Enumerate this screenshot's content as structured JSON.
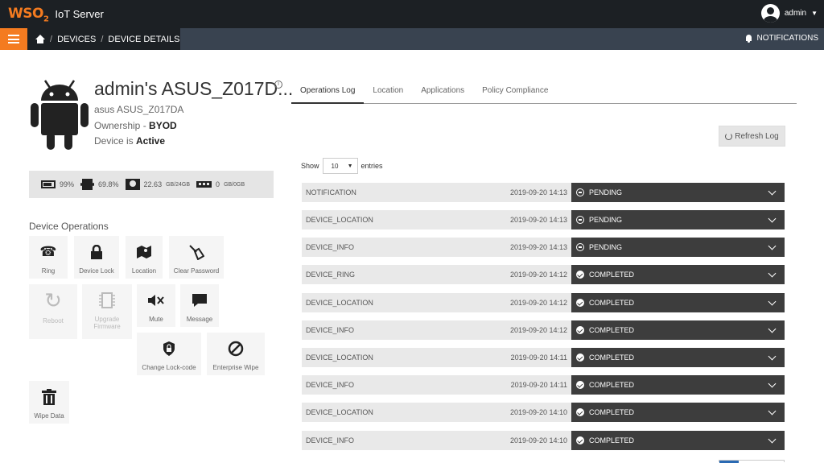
{
  "header": {
    "logo_text": "WSO",
    "logo_sub": "2",
    "app_title": "IoT Server",
    "user_name": "admin",
    "user_avatar_icon": "user-icon"
  },
  "navbar": {
    "menu_icon": "hamburger-icon",
    "breadcrumb": [
      "DEVICES",
      "DEVICE DETAILS"
    ],
    "notifications_label": "NOTIFICATIONS"
  },
  "device": {
    "icon": "android-icon",
    "title": "admin's ASUS_Z017D...",
    "model": "asus ASUS_Z017DA",
    "ownership_label": "Ownership - ",
    "ownership_value": "BYOD",
    "status_label": "Device is ",
    "status_value": "Active"
  },
  "stats": {
    "battery": "99%",
    "cpu": "69.8%",
    "storage_value": "22.63",
    "storage_unit": " GB/24GB",
    "ram_value": "0",
    "ram_unit": " GB/0GB"
  },
  "operations": {
    "title": "Device Operations",
    "items": [
      {
        "label": "Ring",
        "icon": "phone-icon",
        "enabled": true
      },
      {
        "label": "Device Lock",
        "icon": "lock-icon",
        "enabled": true
      },
      {
        "label": "Location",
        "icon": "map-icon",
        "enabled": true
      },
      {
        "label": "Clear Password",
        "icon": "broom-icon",
        "enabled": true
      },
      {
        "label": "Reboot",
        "icon": "reboot-icon",
        "enabled": false
      },
      {
        "label": "Upgrade Firmware",
        "icon": "chip-icon",
        "enabled": false
      },
      {
        "label": "Mute",
        "icon": "mute-icon",
        "enabled": true
      },
      {
        "label": "Message",
        "icon": "message-icon",
        "enabled": true
      },
      {
        "label": "Change Lock-code",
        "icon": "shield-lock-icon",
        "enabled": true
      },
      {
        "label": "Enterprise Wipe",
        "icon": "block-icon",
        "enabled": true
      },
      {
        "label": "Wipe Data",
        "icon": "trash-icon",
        "enabled": true
      }
    ]
  },
  "tabs": [
    "Operations Log",
    "Location",
    "Applications",
    "Policy Compliance"
  ],
  "refresh_label": "Refresh Log",
  "entries": {
    "show_label": "Show",
    "entries_label": "entries",
    "page_size": "10"
  },
  "log_rows": [
    {
      "operation": "NOTIFICATION",
      "time": "2019-09-20 14:13",
      "status": "PENDING"
    },
    {
      "operation": "DEVICE_LOCATION",
      "time": "2019-09-20 14:13",
      "status": "PENDING"
    },
    {
      "operation": "DEVICE_INFO",
      "time": "2019-09-20 14:13",
      "status": "PENDING"
    },
    {
      "operation": "DEVICE_RING",
      "time": "2019-09-20 14:12",
      "status": "COMPLETED"
    },
    {
      "operation": "DEVICE_LOCATION",
      "time": "2019-09-20 14:12",
      "status": "COMPLETED"
    },
    {
      "operation": "DEVICE_INFO",
      "time": "2019-09-20 14:12",
      "status": "COMPLETED"
    },
    {
      "operation": "DEVICE_LOCATION",
      "time": "2019-09-20 14:11",
      "status": "COMPLETED"
    },
    {
      "operation": "DEVICE_INFO",
      "time": "2019-09-20 14:11",
      "status": "COMPLETED"
    },
    {
      "operation": "DEVICE_LOCATION",
      "time": "2019-09-20 14:10",
      "status": "COMPLETED"
    },
    {
      "operation": "DEVICE_INFO",
      "time": "2019-09-20 14:10",
      "status": "COMPLETED"
    }
  ],
  "colors": {
    "accent": "#f47b20",
    "topbar": "#1c2024",
    "navbar": "#394350",
    "status_bar": "#3d3d3d"
  }
}
